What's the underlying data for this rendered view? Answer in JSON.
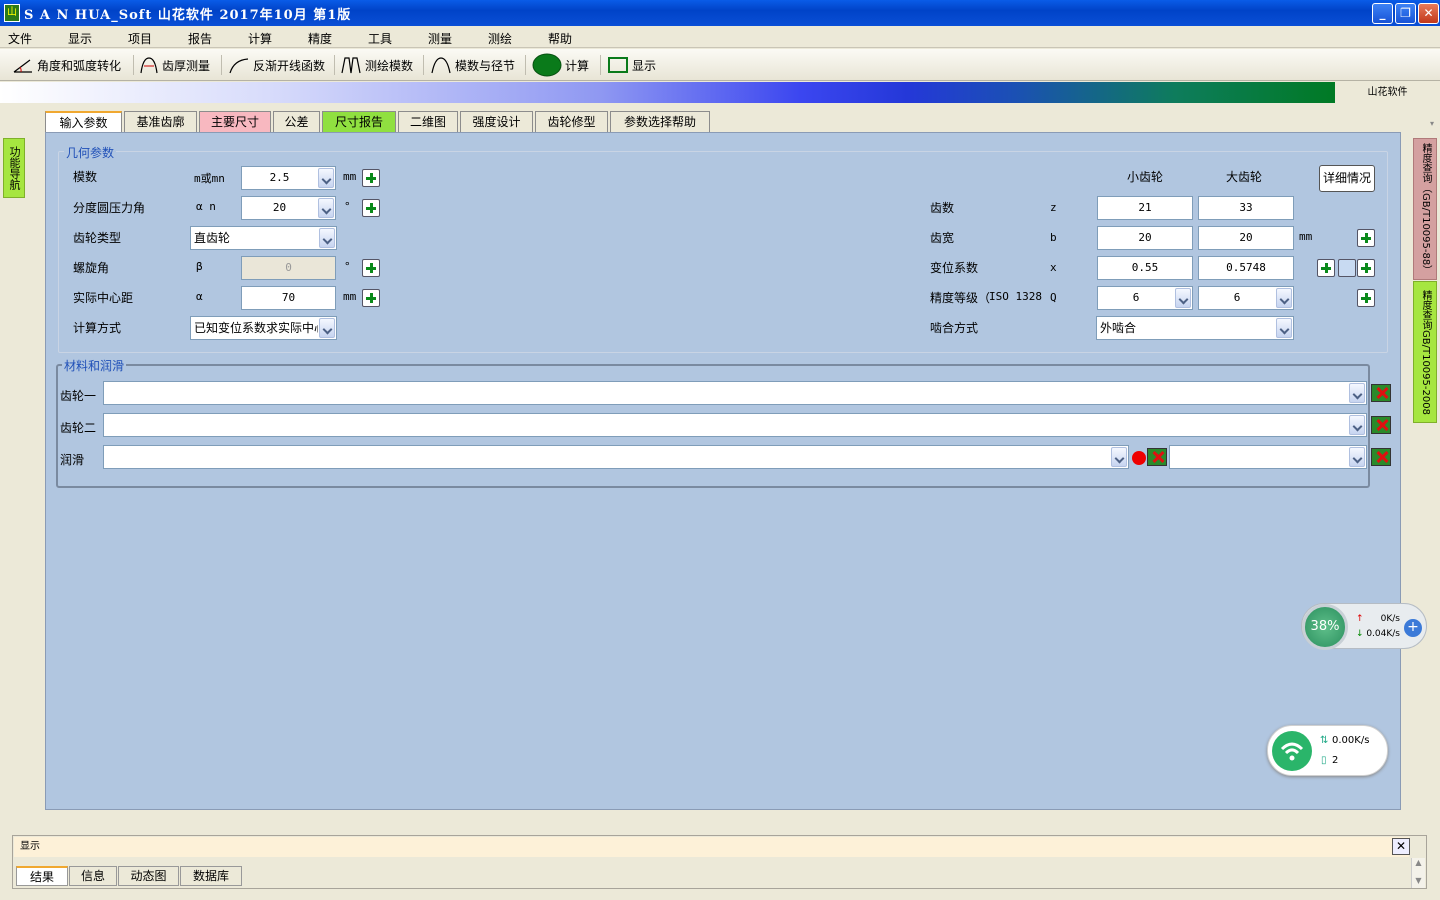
{
  "window": {
    "title": "S A N HUA_Soft 山花软件 2017年10月  第1版"
  },
  "menu": [
    "文件",
    "显示",
    "项目",
    "报告",
    "计算",
    "精度",
    "工具",
    "测量",
    "测绘",
    "帮助"
  ],
  "toolbar": {
    "angle": "角度和弧度转化",
    "thick": "齿厚测量",
    "involute": "反渐开线函数",
    "survey": "测绘模数",
    "pitch": "模数与径节",
    "calc": "计算",
    "display": "显示"
  },
  "banner_label": "山花软件",
  "leftnav": "功能导航",
  "rightnav": [
    "精度查询（GB/T10095-88）",
    "精度查询GB/T10095-2008"
  ],
  "tabs": [
    "输入参数",
    "基准齿廓",
    "主要尺寸",
    "公差",
    "尺寸报告",
    "二维图",
    "强度设计",
    "齿轮修型",
    "参数选择帮助"
  ],
  "geom": {
    "legend": "几何参数",
    "module": {
      "label": "模数",
      "sym": "m或mn",
      "value": "2.5",
      "unit": "mm"
    },
    "pressure": {
      "label": "分度圆压力角",
      "sym": "α n",
      "value": "20",
      "unit": "°"
    },
    "gear_type": {
      "label": "齿轮类型",
      "value": "直齿轮"
    },
    "helix": {
      "label": "螺旋角",
      "sym": "β",
      "value": "0",
      "unit": "°"
    },
    "center": {
      "label": "实际中心距",
      "sym": "α",
      "value": "70",
      "unit": "mm"
    },
    "method": {
      "label": "计算方式",
      "value": "已知变位系数求实际中心距"
    },
    "col_small": "小齿轮",
    "col_big": "大齿轮",
    "detail_btn": "详细情况",
    "teeth": {
      "label": "齿数",
      "sym": "z",
      "small": "21",
      "big": "33"
    },
    "width": {
      "label": "齿宽",
      "sym": "b",
      "small": "20",
      "big": "20",
      "unit": "mm"
    },
    "shift": {
      "label": "变位系数",
      "sym": "x",
      "small": "0.55",
      "big": "0.5748"
    },
    "grade": {
      "label": "精度等级（",
      "std": "ISO 1328",
      "sym": "Q",
      "small": "6",
      "big": "6"
    },
    "mesh": {
      "label": "啮合方式",
      "value": "外啮合"
    }
  },
  "material": {
    "legend": "材料和润滑",
    "gear1": "齿轮一",
    "gear2": "齿轮二",
    "lube": "润滑"
  },
  "bottom": {
    "header": "显示",
    "tabs": [
      "结果",
      "信息",
      "动态图",
      "数据库"
    ]
  },
  "net_widget": {
    "percent": "38%",
    "up": "0K/s",
    "down": "0.04K/s"
  },
  "wifi_widget": {
    "speed": "0.00K/s",
    "count": "2"
  },
  "colors": {
    "main_bg": "#b1c6e0",
    "accent_green": "#a6e640",
    "tab_pink": "#f8b8c0"
  }
}
